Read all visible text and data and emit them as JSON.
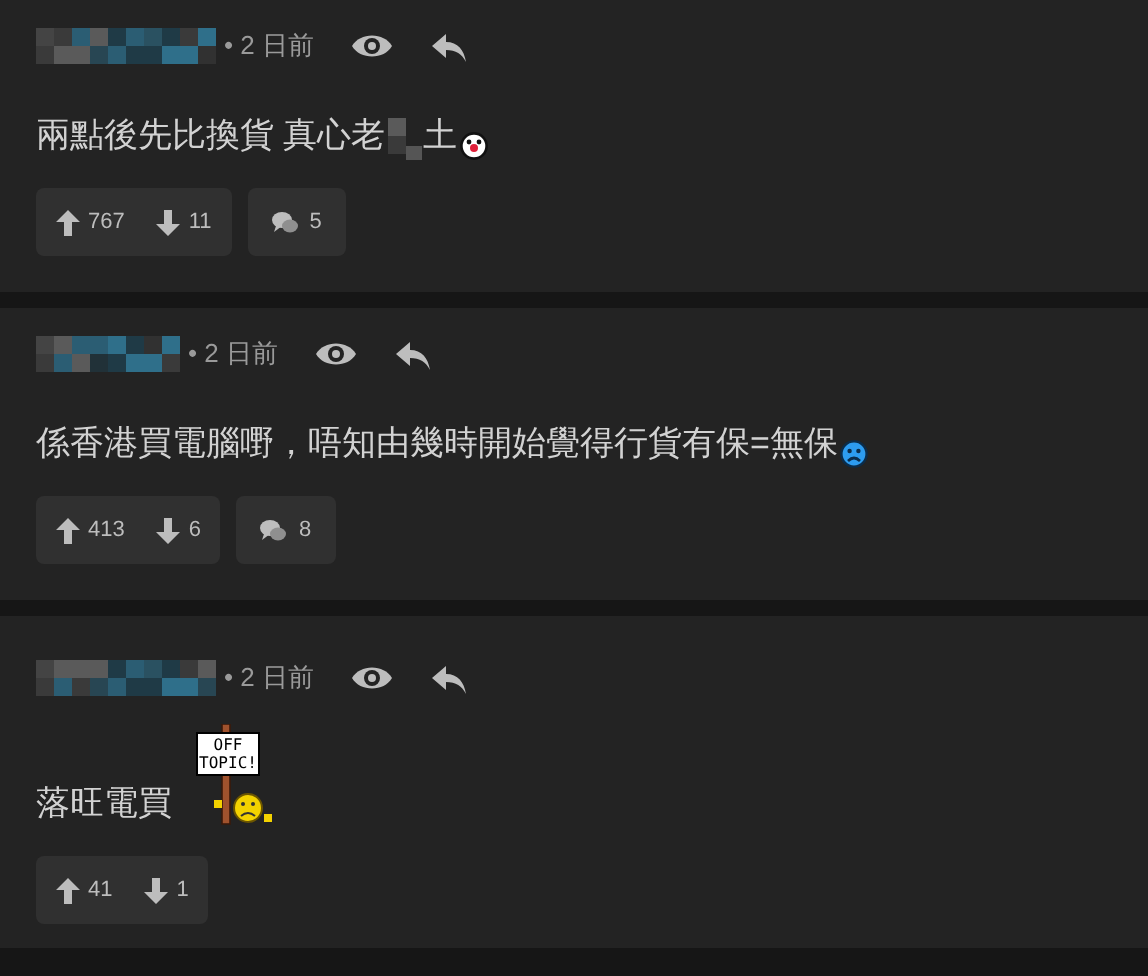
{
  "comments": [
    {
      "time": "• 2 日前",
      "body": [
        {
          "kind": "text",
          "text": "兩點後先比換貨 真心老"
        },
        {
          "kind": "censor"
        },
        {
          "kind": "text",
          "text": "土"
        },
        {
          "kind": "clown"
        }
      ],
      "upvotes": "767",
      "downvotes": "11",
      "replies": "5"
    },
    {
      "time": "• 2 日前",
      "body": [
        {
          "kind": "text",
          "text": "係香港買電腦嘢，唔知由幾時開始覺得行貨有保=無保"
        },
        {
          "kind": "sad"
        }
      ],
      "upvotes": "413",
      "downvotes": "6",
      "replies": "8"
    },
    {
      "time": "• 2 日前",
      "body": [
        {
          "kind": "text",
          "text": "落旺電買"
        },
        {
          "kind": "sign",
          "text": "OFF TOPIC!"
        }
      ],
      "upvotes": "41",
      "downvotes": "1"
    }
  ]
}
